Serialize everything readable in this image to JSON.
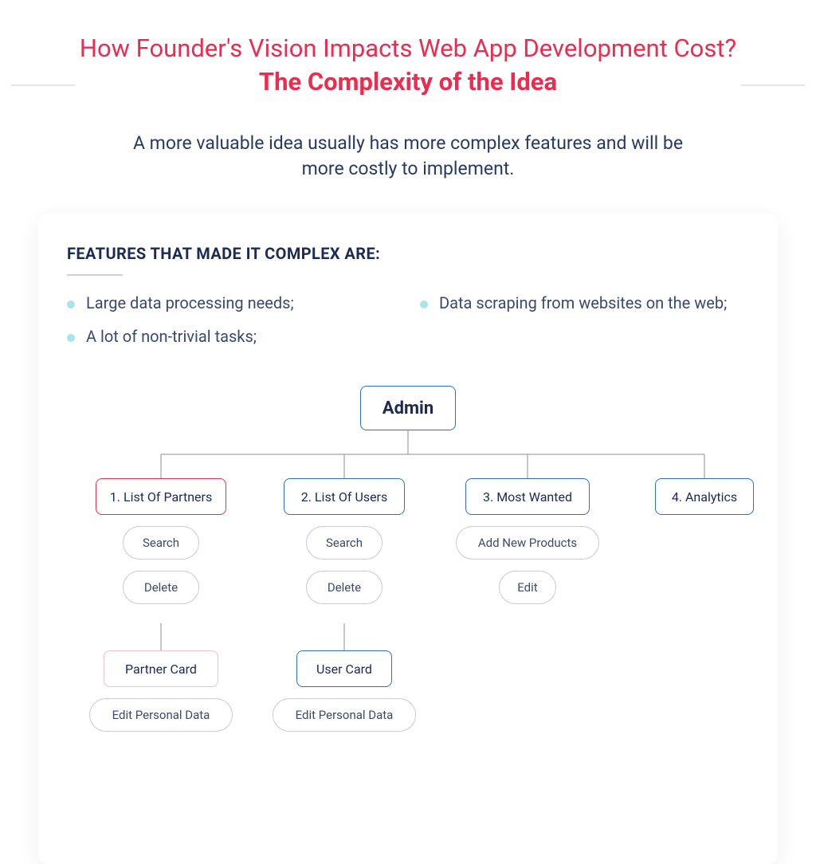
{
  "header": {
    "title_light": "How Founder's Vision Impacts Web App Development Cost? ",
    "title_bold": "The Complexity of the Idea",
    "subtitle": "A more valuable idea usually has more complex features and will be more costly to implement."
  },
  "section": {
    "heading": "FEATURES THAT MADE IT COMPLEX ARE:",
    "bullets": [
      "Large data processing needs;",
      "Data scraping from websites on the web;",
      "A lot of non-trivial tasks;"
    ]
  },
  "diagram": {
    "root": "Admin",
    "branches": [
      {
        "label": "1. List Of Partners",
        "style": "red",
        "actions": [
          "Search",
          "Delete"
        ],
        "card": "Partner Card",
        "card_style": "pink",
        "card_action": "Edit Personal Data"
      },
      {
        "label": "2. List Of Users",
        "style": "blue",
        "actions": [
          "Search",
          "Delete"
        ],
        "card": "User Card",
        "card_style": "blue",
        "card_action": "Edit Personal Data"
      },
      {
        "label": "3. Most Wanted",
        "style": "blue",
        "actions": [
          "Add New Products",
          "Edit"
        ]
      },
      {
        "label": "4. Analytics",
        "style": "blue"
      }
    ]
  }
}
